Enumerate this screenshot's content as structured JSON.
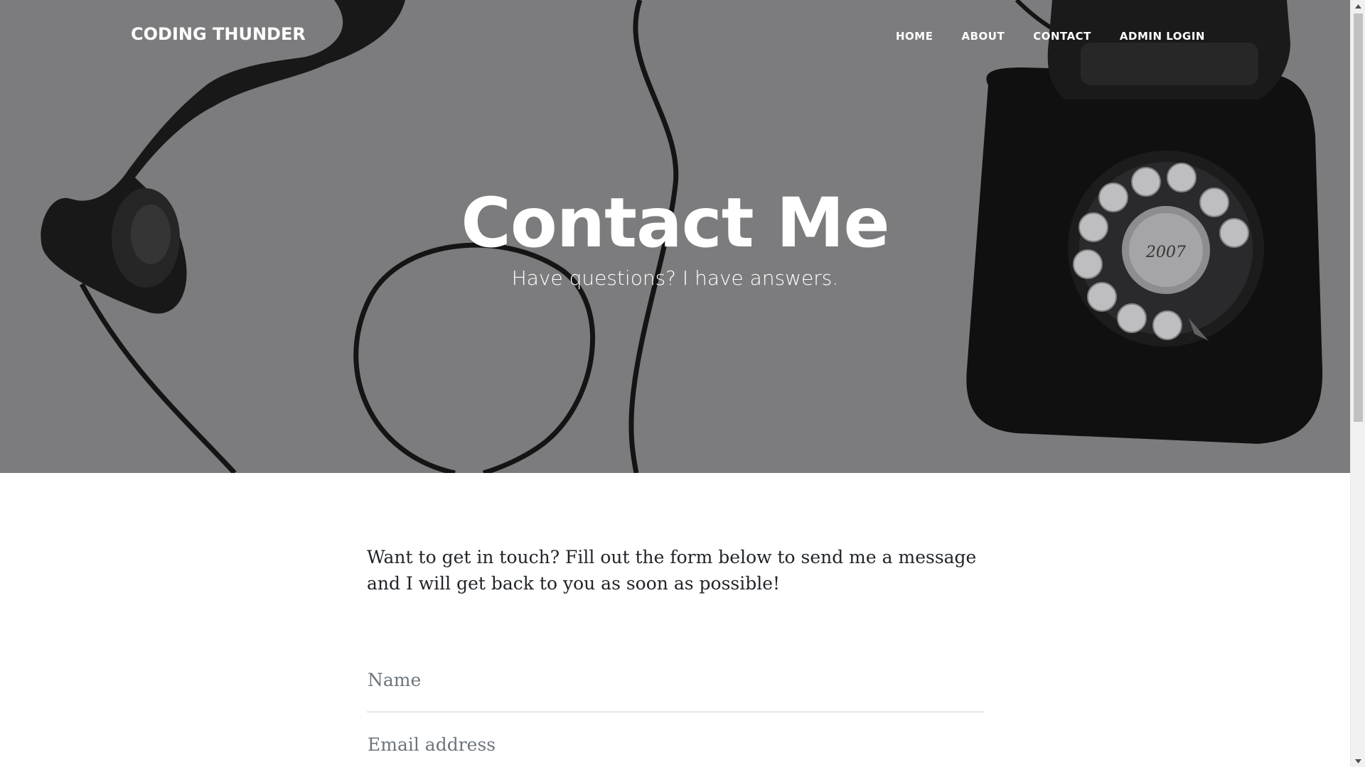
{
  "navbar": {
    "brand": "CODING THUNDER",
    "links": [
      {
        "label": "HOME"
      },
      {
        "label": "ABOUT"
      },
      {
        "label": "CONTACT"
      },
      {
        "label": "ADMIN LOGIN"
      }
    ]
  },
  "hero": {
    "title": "Contact Me",
    "subtitle": "Have questions? I have answers.",
    "background_color": "#8a8a8c",
    "image_semantic": "vintage-rotary-telephone-photo",
    "dial_number_label": "2007"
  },
  "content": {
    "intro": "Want to get in touch? Fill out the form below to send me a message and I will get back to you as soon as possible!",
    "form": {
      "name": {
        "value": "",
        "placeholder": "Name"
      },
      "email": {
        "value": "",
        "placeholder": "Email address"
      }
    }
  },
  "colors": {
    "text": "#212529",
    "placeholder": "#6c757d",
    "divider": "#cfcfcf",
    "scrollbar_track": "#f1f1f1",
    "scrollbar_thumb": "#c1c1c1"
  },
  "icons": {
    "scroll_up": "scroll-up-arrow-icon",
    "scroll_down": "scroll-down-arrow-icon"
  }
}
